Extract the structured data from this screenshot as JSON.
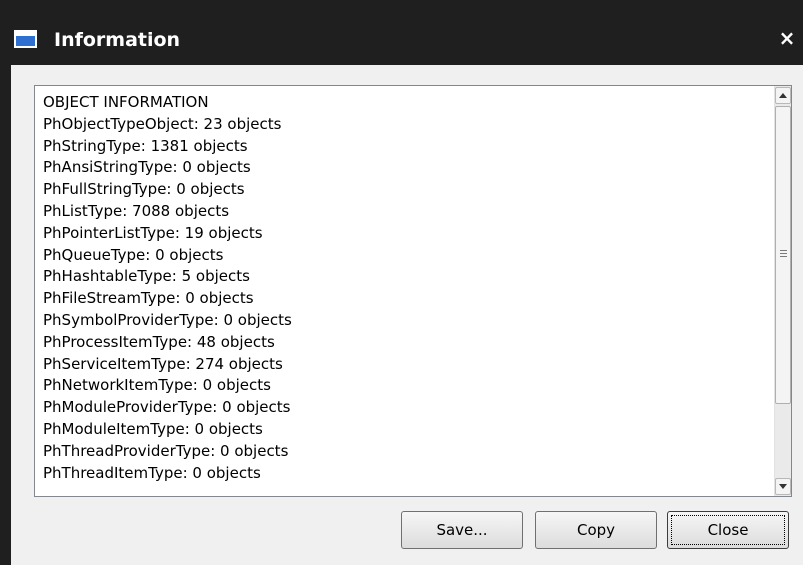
{
  "window": {
    "title": "Information",
    "close_glyph": "×",
    "title_icon": "window-icon"
  },
  "textbox": {
    "lines": [
      "OBJECT INFORMATION",
      "PhObjectTypeObject: 23 objects",
      "PhStringType: 1381 objects",
      "PhAnsiStringType: 0 objects",
      "PhFullStringType: 0 objects",
      "PhListType: 7088 objects",
      "PhPointerListType: 19 objects",
      "PhQueueType: 0 objects",
      "PhHashtableType: 5 objects",
      "PhFileStreamType: 0 objects",
      "PhSymbolProviderType: 0 objects",
      "PhProcessItemType: 48 objects",
      "PhServiceItemType: 274 objects",
      "PhNetworkItemType: 0 objects",
      "PhModuleProviderType: 0 objects",
      "PhModuleItemType: 0 objects",
      "PhThreadProviderType: 0 objects",
      "PhThreadItemType: 0 objects"
    ]
  },
  "buttons": {
    "save": "Save...",
    "copy": "Copy",
    "close": "Close"
  },
  "colors": {
    "titlebar": "#1f1f1f",
    "client": "#f0f0f0",
    "icon_blue": "#2f6fd0"
  }
}
